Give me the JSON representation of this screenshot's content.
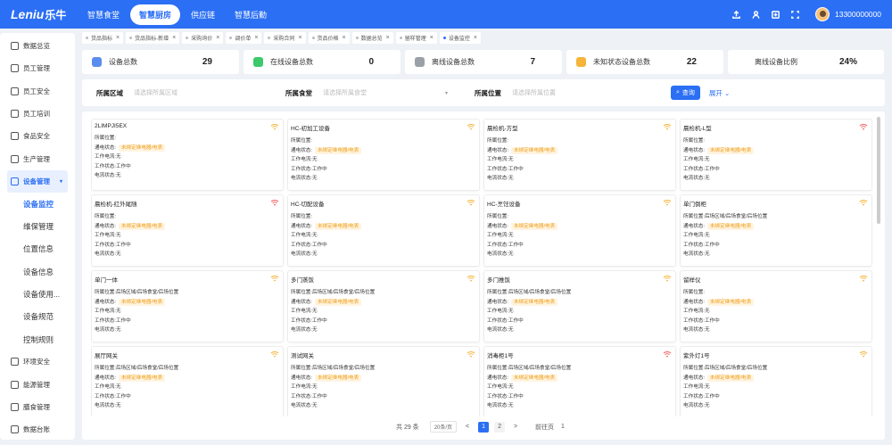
{
  "header": {
    "logo_text": "Leniu",
    "logo_cn": "乐牛",
    "nav": [
      "智慧食堂",
      "智慧厨房",
      "供应链",
      "智慧后勤"
    ],
    "active_nav_index": 1,
    "icons": [
      "upload-icon",
      "user-icon",
      "settings-icon",
      "fullscreen-icon"
    ],
    "phone": "13300000000"
  },
  "sidebar": {
    "items": [
      {
        "label": "数据总览",
        "icon": "dashboard-icon"
      },
      {
        "label": "员工管理",
        "icon": "staff-icon"
      },
      {
        "label": "员工安全",
        "icon": "shield-icon"
      },
      {
        "label": "员工培训",
        "icon": "training-icon"
      },
      {
        "label": "食品安全",
        "icon": "food-icon"
      },
      {
        "label": "生产管理",
        "icon": "production-icon"
      },
      {
        "label": "设备管理",
        "icon": "device-icon"
      }
    ],
    "sub_items": [
      "设备监控",
      "维保管理",
      "位置信息",
      "设备信息",
      "设备使用...",
      "设备规范",
      "控制规则"
    ],
    "bottom_items": [
      {
        "label": "环境安全",
        "icon": "environment-icon"
      },
      {
        "label": "能源管理",
        "icon": "energy-icon"
      },
      {
        "label": "膳食管理",
        "icon": "meal-icon"
      },
      {
        "label": "数据台账",
        "icon": "ledger-icon"
      }
    ]
  },
  "tabs": [
    "货品指标",
    "货品指标-新增",
    "采购询价",
    "调价单",
    "采购合同",
    "货品价格",
    "数据总览",
    "留样管理",
    "设备监控"
  ],
  "active_tab_index": 8,
  "stats": [
    {
      "label": "设备总数",
      "value": "29",
      "color": "#5b8def"
    },
    {
      "label": "在线设备总数",
      "value": "0",
      "color": "#3cc96b"
    },
    {
      "label": "离线设备总数",
      "value": "7",
      "color": "#9aa0a8"
    },
    {
      "label": "未知状态设备总数",
      "value": "22",
      "color": "#f5b43a"
    },
    {
      "label": "离线设备比例",
      "value": "24%"
    }
  ],
  "filter": {
    "area_label": "所属区域",
    "area_placeholder": "请选择所属区域",
    "canteen_label": "所属食堂",
    "canteen_placeholder": "请选择所属食堂",
    "position_label": "所属位置",
    "position_placeholder": "请选择所属位置",
    "query": "查询",
    "expand": "展开"
  },
  "field_labels": {
    "position": "所属位置:",
    "channel": "通电状态:",
    "current": "工作电流:",
    "work": "工作状态:",
    "power": "电流状态:"
  },
  "channel_tag": "未绑定继电器/电表",
  "devices": [
    {
      "name": "2LIMPJI5EX",
      "position": "",
      "current": "无",
      "work": "工作中",
      "power": "无",
      "signal": "ok"
    },
    {
      "name": "HC-初加工设备",
      "position": "",
      "current": "无",
      "work": "工作中",
      "power": "无",
      "signal": "ok"
    },
    {
      "name": "晨检机-方型",
      "position": "",
      "current": "无",
      "work": "工作中",
      "power": "无",
      "signal": "ok"
    },
    {
      "name": "晨检机-L型",
      "position": "",
      "current": "无",
      "work": "工作中",
      "power": "无",
      "signal": "bad"
    },
    {
      "name": "晨检机-红外尾随",
      "position": "",
      "current": "无",
      "work": "工作中",
      "power": "无",
      "signal": "bad"
    },
    {
      "name": "HC-切配设备",
      "position": "",
      "current": "无",
      "work": "工作中",
      "power": "无",
      "signal": "ok"
    },
    {
      "name": "HC-烹饪设备",
      "position": "",
      "current": "无",
      "work": "工作中",
      "power": "无",
      "signal": "ok"
    },
    {
      "name": "单门倒柜",
      "position": "后场区域/后场食堂/后场位置",
      "current": "无",
      "work": "工作中",
      "power": "无",
      "signal": "ok"
    },
    {
      "name": "单门一体",
      "position": "后场区域/后场食堂/后场位置",
      "current": "无",
      "work": "工作中",
      "power": "无",
      "signal": "ok"
    },
    {
      "name": "多门蒸饭",
      "position": "后场区域/后场食堂/后场位置",
      "current": "无",
      "work": "工作中",
      "power": "无",
      "signal": "ok"
    },
    {
      "name": "多门推饭",
      "position": "后场区域/后场食堂/后场位置",
      "current": "无",
      "work": "工作中",
      "power": "无",
      "signal": "ok"
    },
    {
      "name": "留样仪",
      "position": "",
      "current": "无",
      "work": "工作中",
      "power": "无",
      "signal": "ok"
    },
    {
      "name": "展厅网关",
      "position": "后场区域/后场食堂/后场位置",
      "current": "无",
      "work": "工作中",
      "power": "无",
      "signal": "ok"
    },
    {
      "name": "测试网关",
      "position": "后场区域/后场食堂/后场位置",
      "current": "无",
      "work": "工作中",
      "power": "无",
      "signal": "ok"
    },
    {
      "name": "消毒柜1号",
      "position": "后场区域/后场食堂/后场位置",
      "current": "无",
      "work": "工作中",
      "power": "无",
      "signal": "bad"
    },
    {
      "name": "紫外灯1号",
      "position": "后场区域/后场食堂/后场位置",
      "current": "无",
      "work": "工作中",
      "power": "无",
      "signal": "ok"
    }
  ],
  "pager": {
    "total": "共 29 条",
    "size": "20条/页",
    "prev": "<",
    "pages": [
      "1",
      "2"
    ],
    "current_page": 1,
    "next": ">",
    "goto": "前往页",
    "goto_value": "1"
  },
  "colors": {
    "accent": "#2b6ff4",
    "signal_ok": "#f5b43a",
    "signal_bad": "#f26161"
  }
}
